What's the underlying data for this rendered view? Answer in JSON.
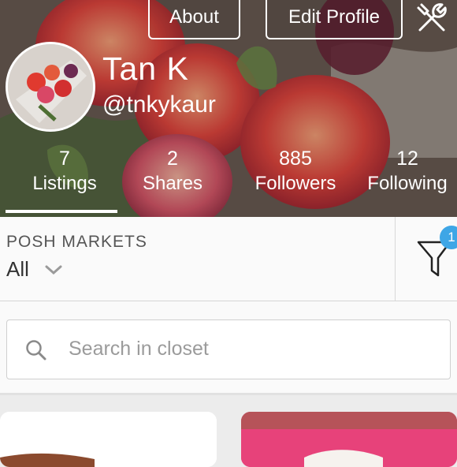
{
  "header": {
    "about_label": "About",
    "edit_profile_label": "Edit Profile",
    "tools_icon": "tools-icon",
    "name": "Tan K",
    "handle": "@tnkykaur"
  },
  "stats": [
    {
      "value": "7",
      "label": "Listings"
    },
    {
      "value": "2",
      "label": "Shares"
    },
    {
      "value": "885",
      "label": "Followers"
    },
    {
      "value": "12",
      "label": "Following"
    }
  ],
  "filter": {
    "title": "POSH MARKETS",
    "value": "All",
    "badge_count": "1"
  },
  "search": {
    "placeholder": "Search in closet"
  },
  "colors": {
    "accent_badge": "#3ea6e6",
    "card2": "#e7427a"
  }
}
